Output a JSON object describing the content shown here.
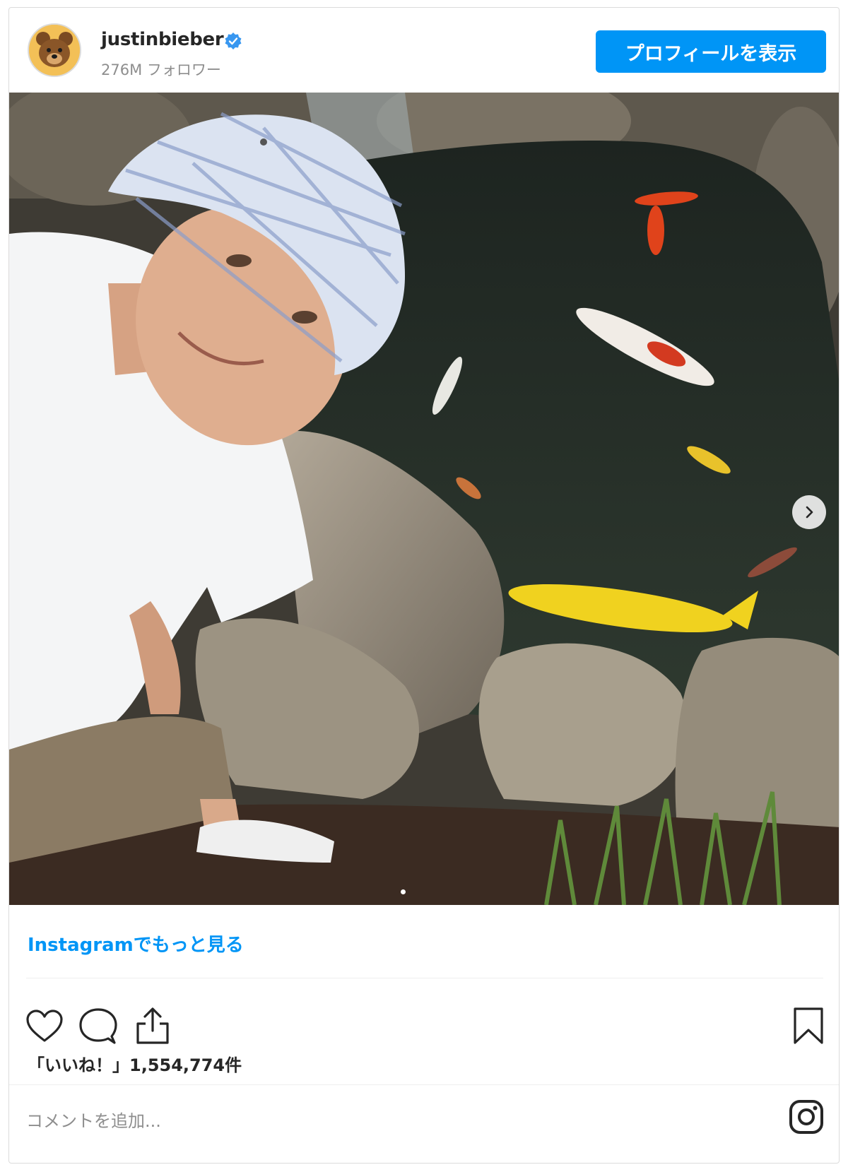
{
  "header": {
    "username": "justinbieber",
    "followers": "276M フォロワー",
    "profile_button": "プロフィールを表示",
    "avatar_icon": "bear-avatar-icon",
    "verified_icon": "verified-badge-icon"
  },
  "post": {
    "photo_alt": "selfie-by-koi-pond",
    "next_icon": "chevron-right-icon",
    "more_link": "Instagramでもっと見る"
  },
  "actions": {
    "like_icon": "heart-icon",
    "comment_icon": "comment-icon",
    "share_icon": "share-icon",
    "save_icon": "bookmark-icon"
  },
  "likes": {
    "text": "「いいね！」1,554,774件"
  },
  "comment": {
    "placeholder": "コメントを追加...",
    "instagram_icon": "instagram-logo-icon"
  },
  "colors": {
    "accent": "#0095f6",
    "text": "#262626",
    "muted": "#8e8e8e"
  }
}
